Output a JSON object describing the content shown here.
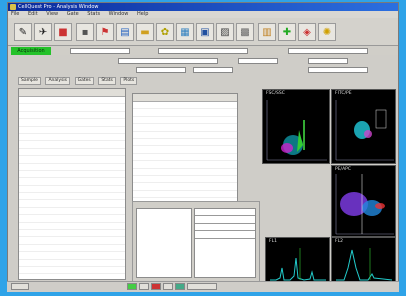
{
  "window": {
    "title": "CellQuest Pro - Analysis Window"
  },
  "menu": [
    "File",
    "Edit",
    "View",
    "Gate",
    "Stats",
    "Window",
    "Help"
  ],
  "status": {
    "green_label": "Acquisition"
  },
  "tabs": [
    "Sample",
    "Analysis",
    "Gates",
    "Stats",
    "Plots"
  ],
  "plots": [
    {
      "name": "FSC/SSC"
    },
    {
      "name": "FITC/PE"
    },
    {
      "name": "PE/APC"
    },
    {
      "name": "FL1"
    },
    {
      "name": "FL2"
    }
  ],
  "colors": {
    "accent_green": "#24c22a",
    "titlebar": "#0b2b9c",
    "background": "#2fa3e8"
  }
}
